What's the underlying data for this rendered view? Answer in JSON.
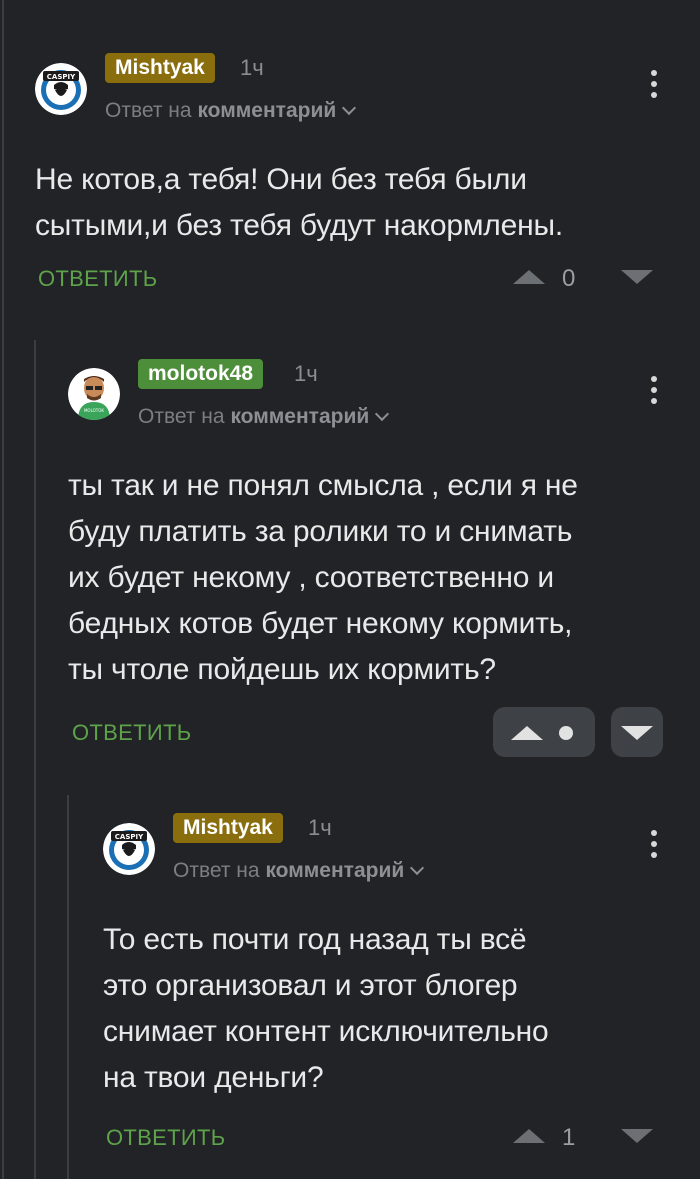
{
  "comments": [
    {
      "author": "Mishtyak",
      "time": "1ч",
      "reply_to_prefix": "Ответ на",
      "reply_to_target": "комментарий",
      "text": "Не котов,а тебя! Они без тебя были\nсытыми,и без тебя будут накормлены.",
      "reply_label": "ОТВЕТИТЬ",
      "score": "0",
      "avatar_text": "CASPIY",
      "author_color": "#8a6d0c"
    },
    {
      "author": "molotok48",
      "time": "1ч",
      "reply_to_prefix": "Ответ на",
      "reply_to_target": "комментарий",
      "text": "ты так и не понял смысла , если я не\nбуду платить за ролики то и снимать\nих будет некому , соответственно и\nбедных котов будет некому кормить,\nты чтоле пойдешь их кормить?",
      "reply_label": "ОТВЕТИТЬ",
      "author_color": "#4d8e3a"
    },
    {
      "author": "Mishtyak",
      "time": "1ч",
      "reply_to_prefix": "Ответ на",
      "reply_to_target": "комментарий",
      "text": "То есть почти год назад ты всё\nэто организовал и этот блогер\nснимает контент исключительно\nна твои деньги?",
      "reply_label": "ОТВЕТИТЬ",
      "score": "1",
      "avatar_text": "CASPIY",
      "author_color": "#8a6d0c"
    }
  ]
}
